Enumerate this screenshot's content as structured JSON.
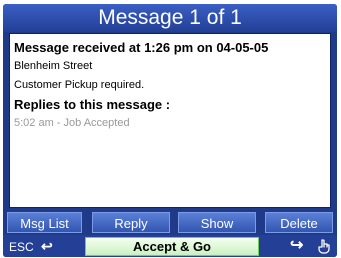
{
  "header": {
    "title": "Message 1 of 1"
  },
  "message": {
    "received_line": "Message received at 1:26 pm on 04-05-05",
    "street": "Blenheim Street",
    "note": "Customer Pickup required.",
    "replies_heading": "Replies to this message :",
    "replies": [
      "5:02 am - Job Accepted"
    ]
  },
  "softkeys": {
    "msg_list": "Msg List",
    "reply": "Reply",
    "show": "Show",
    "delete": "Delete"
  },
  "bottom": {
    "esc_label": "ESC",
    "accept_label": "Accept & Go",
    "back_icon": "return-arrow-icon",
    "forward_icon": "forward-arrow-icon",
    "hand_icon": "pointing-hand-icon"
  },
  "colors": {
    "frame": "#1f3a88",
    "button": "#3356b0",
    "accept_bg": "#c9f1c0",
    "accept_border": "#6fcf57",
    "reply_text": "#9a9a9a"
  }
}
